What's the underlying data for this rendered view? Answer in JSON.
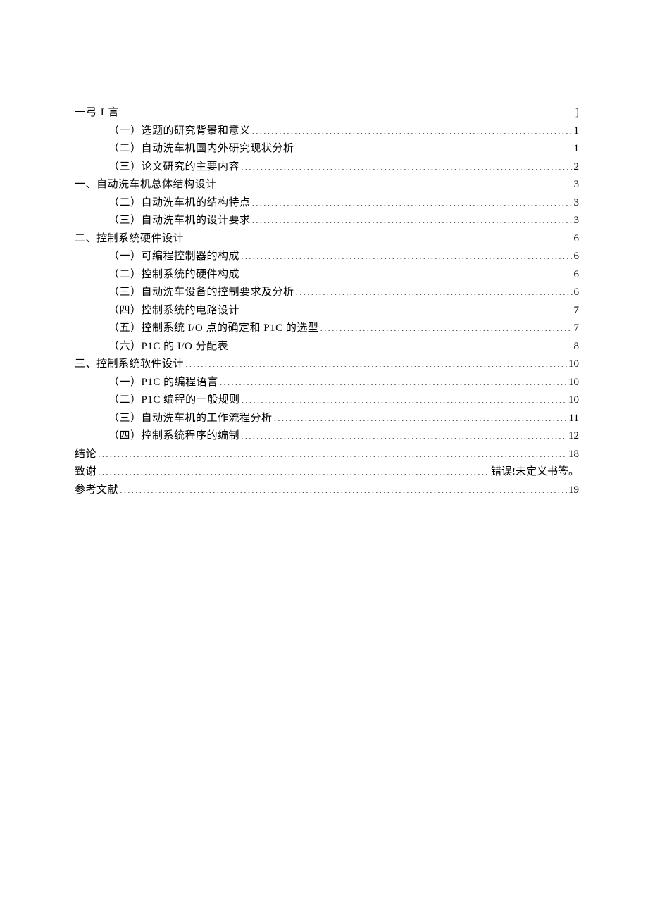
{
  "toc": {
    "first_heading_left": "一弓 I 言",
    "first_heading_right": "]",
    "entries": [
      {
        "level": 2,
        "text": "（一）选题的研究背景和意义",
        "page": "1"
      },
      {
        "level": 2,
        "text": "（二）自动洗车机国内外研究现状分析",
        "page": "1"
      },
      {
        "level": 2,
        "text": "（三）论文研究的主要内容",
        "page": "2"
      },
      {
        "level": 1,
        "text": "一、自动洗车机总体结构设计",
        "page": "3"
      },
      {
        "level": 2,
        "text": "（二）自动洗车机的结构特点",
        "page": "3"
      },
      {
        "level": 2,
        "text": "（三）自动洗车机的设计要求",
        "page": "3"
      },
      {
        "level": 1,
        "text": "二、控制系统硬件设计",
        "page": "6"
      },
      {
        "level": 2,
        "text": "（一）可编程控制器的构成",
        "page": "6"
      },
      {
        "level": 2,
        "text": "（二）控制系统的硬件构成",
        "page": "6"
      },
      {
        "level": 2,
        "text": "（三）自动洗车设备的控制要求及分析",
        "page": "6"
      },
      {
        "level": 2,
        "text": "（四）控制系统的电路设计",
        "page": "7"
      },
      {
        "level": 2,
        "text": "（五）控制系统 I/O 点的确定和 P1C 的选型",
        "page": "7"
      },
      {
        "level": 2,
        "text": "（六）P1C 的 I/O 分配表",
        "page": "8"
      },
      {
        "level": 1,
        "text": "三、控制系统软件设计",
        "page": "10"
      },
      {
        "level": 2,
        "text": "（一）P1C 的编程语言",
        "page": "10"
      },
      {
        "level": 2,
        "text": "（二）P1C 编程的一般规则",
        "page": "10"
      },
      {
        "level": 2,
        "text": "（三）自动洗车机的工作流程分析",
        "page": "11"
      },
      {
        "level": 2,
        "text": "（四）控制系统程序的编制",
        "page": "12"
      },
      {
        "level": 1,
        "text": "结论",
        "page": "18"
      },
      {
        "level": 1,
        "text": "致谢",
        "page": "错误!未定义书签。",
        "error": true
      },
      {
        "level": 1,
        "text": "参考文献",
        "page": "19"
      }
    ]
  }
}
